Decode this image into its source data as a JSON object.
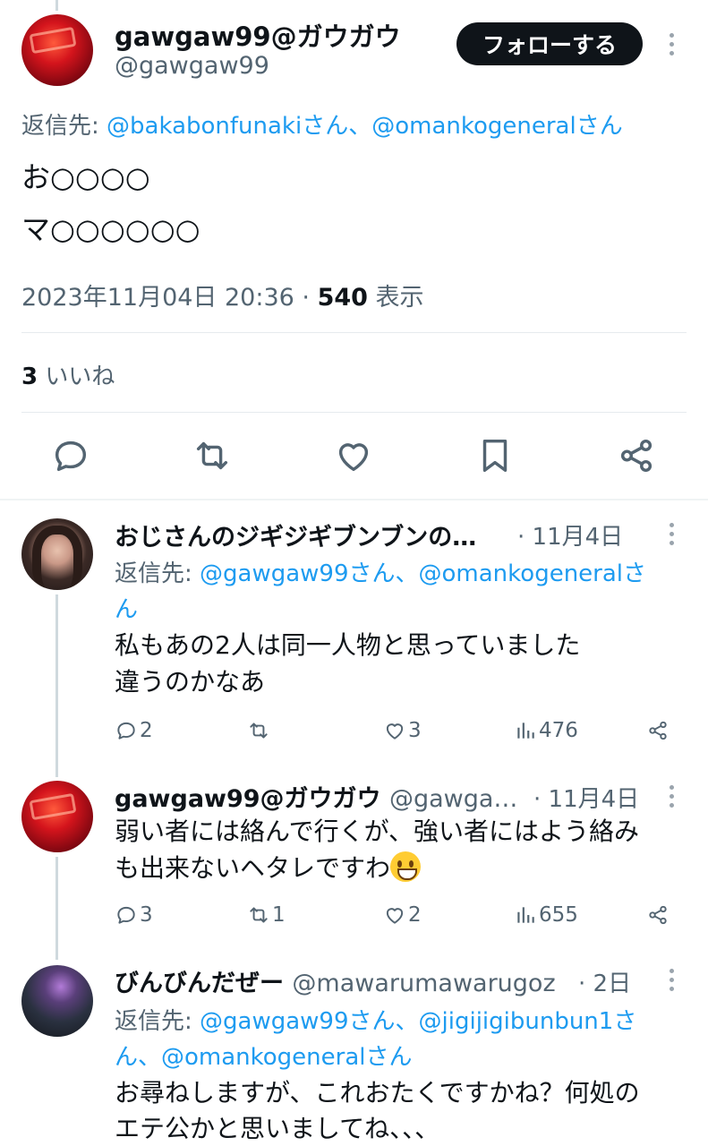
{
  "main_tweet": {
    "display_name": "gawgaw99@ガウガウ",
    "handle": "@gawgaw99",
    "follow_label": "フォローする",
    "reply_prefix": "返信先: ",
    "reply_to": "@bakabonfunakiさん、@omankogeneralさん",
    "text_line1": "お○○○○",
    "text_line2": "マ○○○○○○",
    "timestamp": "2023年11月04日 20:36 · ",
    "views_count": "540",
    "views_label": " 表示",
    "likes_count": "3",
    "likes_label": " いいね"
  },
  "replies": [
    {
      "display_name": "おじさんのジギジギブンブンの…",
      "time": "· 11月4日",
      "reply_prefix": "返信先: ",
      "reply_to_line1": "@gawgaw99さん、@omankogeneralさ",
      "reply_to_line2": "ん",
      "text_line1": "私もあの2人は同一人物と思っていました",
      "text_line2": "違うのかなあ",
      "reply_count": "2",
      "retweet_count": "",
      "like_count": "3",
      "view_count": "476"
    },
    {
      "display_name": "gawgaw99@ガウガウ",
      "handle": "@gawga…",
      "time": "· 11月4日",
      "text_line1": "弱い者には絡んで行くが、強い者にはよう絡み",
      "text_line2": "も出来ないヘタレですわ",
      "emoji": "grinning-face-emoji",
      "reply_count": "3",
      "retweet_count": "1",
      "like_count": "2",
      "view_count": "655"
    },
    {
      "display_name": "びんびんだぜー",
      "handle": "@mawarumawarugoz",
      "time": "· 2日",
      "reply_prefix": "返信先: ",
      "reply_to_line1": "@gawgaw99さん、@jigijigibunbun1さ",
      "reply_to_line2": "ん、@omankogeneralさん",
      "text_line1": "お尋ねしますが、これおたくですかね？何処の",
      "text_line2": "エテ公かと思いましてね、、、"
    }
  ],
  "colors": {
    "text": "#0f1419",
    "secondary": "#536471",
    "link": "#1d9bf0",
    "button_bg": "#0f1419"
  }
}
